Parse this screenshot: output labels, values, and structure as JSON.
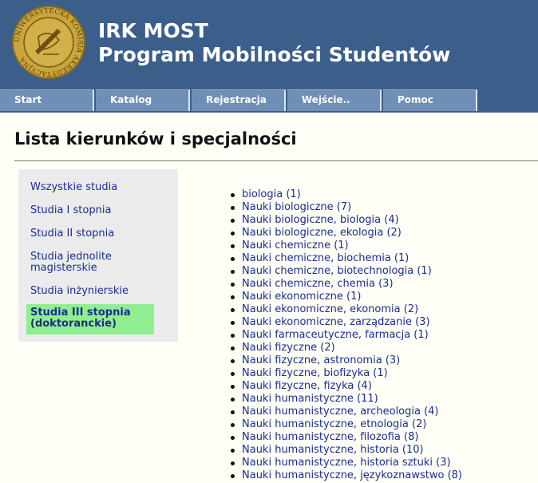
{
  "header": {
    "title": "IRK MOST",
    "subtitle": "Program Mobilności Studentów",
    "seal_text": "UNIWERSYTECKA KOMISJA AKREDYTACYJNA"
  },
  "nav": [
    "Start",
    "Katalog",
    "Rejestracja",
    "Wejście..",
    "Pomoc"
  ],
  "page_title": "Lista kierunków i specjalności",
  "sidebar": {
    "items": [
      "Wszystkie studia",
      "Studia I stopnia",
      "Studia II stopnia",
      "Studia jednolite\nmagisterskie",
      "Studia inżynierskie"
    ],
    "active": "Studia III stopnia\n(doktoranckie)"
  },
  "list": [
    "biologia (1)",
    "Nauki biologiczne (7)",
    "Nauki biologiczne, biologia (4)",
    "Nauki biologiczne, ekologia (2)",
    "Nauki chemiczne (1)",
    "Nauki chemiczne, biochemia (1)",
    "Nauki chemiczne, biotechnologia (1)",
    "Nauki chemiczne, chemia (3)",
    "Nauki ekonomiczne (1)",
    "Nauki ekonomiczne, ekonomia (2)",
    "Nauki ekonomiczne, zarządzanie (3)",
    "Nauki farmaceutyczne, farmacja (1)",
    "Nauki fizyczne (2)",
    "Nauki fizyczne, astronomia (3)",
    "Nauki fizyczne, biofizyka (1)",
    "Nauki fizyczne, fizyka (4)",
    "Nauki humanistyczne (11)",
    "Nauki humanistyczne, archeologia (4)",
    "Nauki humanistyczne, etnologia (2)",
    "Nauki humanistyczne, filozofia (8)",
    "Nauki humanistyczne, historia (10)",
    "Nauki humanistyczne, historia sztuki (3)",
    "Nauki humanistyczne, językoznawstwo (8)"
  ],
  "colors": {
    "header_bg": "#3b5f8a",
    "nav_bg": "#6f8fb6",
    "link": "#1a2d8f",
    "active_bg": "#90ee90",
    "sidebar_bg": "#ebebeb",
    "seal_gold": "#c9a53c"
  }
}
